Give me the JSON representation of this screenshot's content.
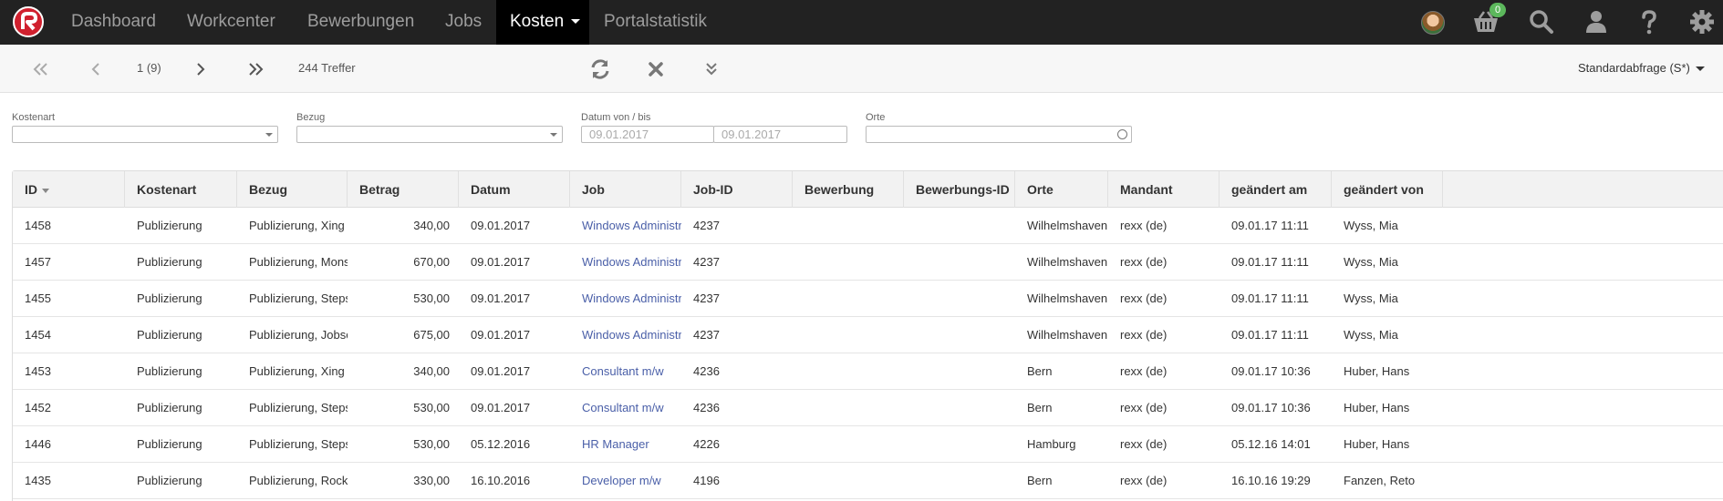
{
  "navbar": {
    "menu": [
      {
        "label": "Dashboard",
        "active": false
      },
      {
        "label": "Workcenter",
        "active": false
      },
      {
        "label": "Bewerbungen",
        "active": false
      },
      {
        "label": "Jobs",
        "active": false
      },
      {
        "label": "Kosten",
        "active": true
      },
      {
        "label": "Portalstatistik",
        "active": false
      }
    ],
    "cart_count": "0",
    "icons": [
      "logo-icon",
      "avatar",
      "cart-icon",
      "search-icon",
      "user-icon",
      "help-icon",
      "gear-icon"
    ]
  },
  "toolbar": {
    "page_indicator": "1 (9)",
    "hits": "244 Treffer",
    "query_selector": "Standardabfrage (S*)"
  },
  "filters": {
    "kostenart": {
      "label": "Kostenart",
      "value": ""
    },
    "bezug": {
      "label": "Bezug",
      "value": ""
    },
    "datum": {
      "label": "Datum von / bis",
      "from_placeholder": "09.01.2017",
      "to_placeholder": "09.01.2017"
    },
    "orte": {
      "label": "Orte",
      "value": ""
    }
  },
  "table": {
    "columns": [
      "ID",
      "Kostenart",
      "Bezug",
      "Betrag",
      "Datum",
      "Job",
      "Job-ID",
      "Bewerbung",
      "Bewerbungs-ID",
      "Orte",
      "Mandant",
      "geändert am",
      "geändert von"
    ],
    "rows": [
      [
        "1458",
        "Publizierung",
        "Publizierung, Xing",
        "340,00",
        "09.01.2017",
        "Windows Administrator",
        "4237",
        "",
        "",
        "Wilhelmshaven",
        "rexx (de)",
        "09.01.17 11:11",
        "Wyss, Mia"
      ],
      [
        "1457",
        "Publizierung",
        "Publizierung, Monster",
        "670,00",
        "09.01.2017",
        "Windows Administrator",
        "4237",
        "",
        "",
        "Wilhelmshaven",
        "rexx (de)",
        "09.01.17 11:11",
        "Wyss, Mia"
      ],
      [
        "1455",
        "Publizierung",
        "Publizierung, Stepstone",
        "530,00",
        "09.01.2017",
        "Windows Administrator",
        "4237",
        "",
        "",
        "Wilhelmshaven",
        "rexx (de)",
        "09.01.17 11:11",
        "Wyss, Mia"
      ],
      [
        "1454",
        "Publizierung",
        "Publizierung, Jobscout",
        "675,00",
        "09.01.2017",
        "Windows Administrator",
        "4237",
        "",
        "",
        "Wilhelmshaven",
        "rexx (de)",
        "09.01.17 11:11",
        "Wyss, Mia"
      ],
      [
        "1453",
        "Publizierung",
        "Publizierung, Xing",
        "340,00",
        "09.01.2017",
        "Consultant m/w",
        "4236",
        "",
        "",
        "Bern",
        "rexx (de)",
        "09.01.17 10:36",
        "Huber, Hans"
      ],
      [
        "1452",
        "Publizierung",
        "Publizierung, Stepstone",
        "530,00",
        "09.01.2017",
        "Consultant m/w",
        "4236",
        "",
        "",
        "Bern",
        "rexx (de)",
        "09.01.17 10:36",
        "Huber, Hans"
      ],
      [
        "1446",
        "Publizierung",
        "Publizierung, Stepstone",
        "530,00",
        "05.12.2016",
        "HR Manager",
        "4226",
        "",
        "",
        "Hamburg",
        "rexx (de)",
        "05.12.16 14:01",
        "Huber, Hans"
      ],
      [
        "1435",
        "Publizierung",
        "Publizierung, Rocket",
        "330,00",
        "16.10.2016",
        "Developer m/w",
        "4196",
        "",
        "",
        "Bern",
        "rexx (de)",
        "16.10.16 19:29",
        "Fanzen, Reto"
      ]
    ]
  }
}
